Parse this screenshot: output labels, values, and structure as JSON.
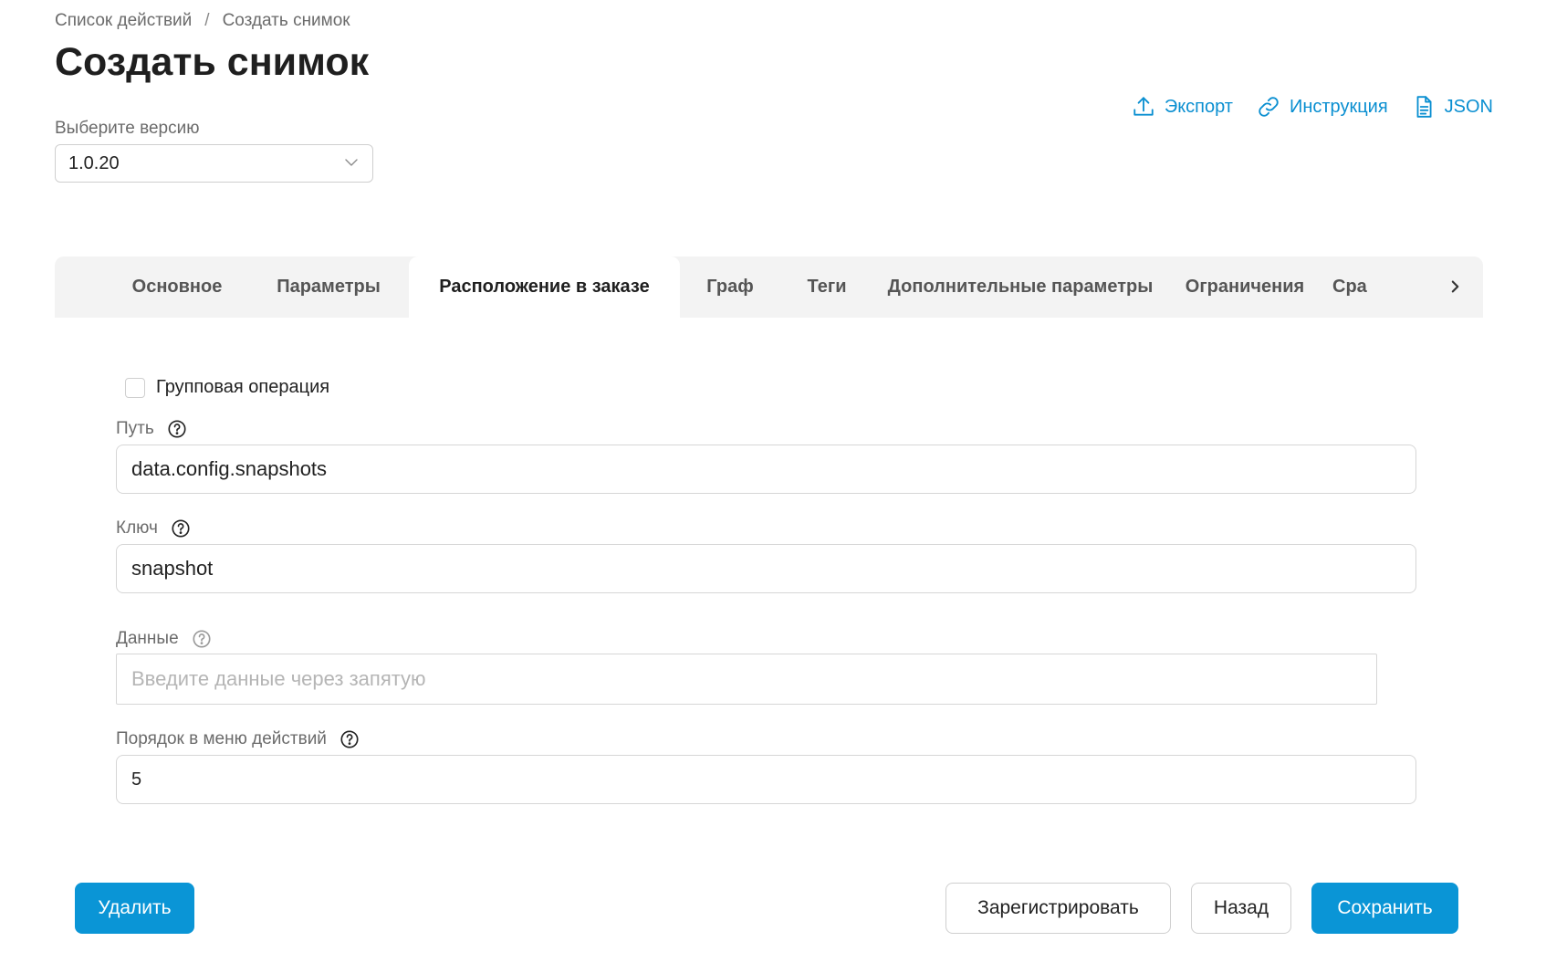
{
  "breadcrumb": {
    "items": [
      "Список действий",
      "Создать снимок"
    ],
    "separator": "/"
  },
  "page": {
    "title": "Создать снимок"
  },
  "header_actions": [
    {
      "label": "Экспорт",
      "icon": "upload-icon"
    },
    {
      "label": "Инструкция",
      "icon": "link-icon"
    },
    {
      "label": "JSON",
      "icon": "document-icon"
    }
  ],
  "version": {
    "label": "Выберите версию",
    "value": "1.0.20"
  },
  "tabs": {
    "items": [
      {
        "label": "Основное"
      },
      {
        "label": "Параметры"
      },
      {
        "label": "Расположение в заказе"
      },
      {
        "label": "Граф"
      },
      {
        "label": "Теги"
      },
      {
        "label": "Дополнительные параметры"
      },
      {
        "label": "Ограничения"
      },
      {
        "label": "Сра"
      }
    ],
    "active": "Расположение в заказе"
  },
  "form": {
    "group_operation": {
      "label": "Групповая операция",
      "checked": false
    },
    "path": {
      "label": "Путь",
      "value": "data.config.snapshots"
    },
    "key": {
      "label": "Ключ",
      "value": "snapshot"
    },
    "data": {
      "label": "Данные",
      "value": "",
      "placeholder": "Введите данные через запятую"
    },
    "order": {
      "label": "Порядок в меню действий",
      "value": "5"
    }
  },
  "buttons": {
    "delete": "Удалить",
    "register": "Зарегистрировать",
    "back": "Назад",
    "save": "Сохранить"
  },
  "colors": {
    "accent": "#0a95d6",
    "link": "#0a8fd1",
    "tabs_bg": "#f3f3f3"
  }
}
